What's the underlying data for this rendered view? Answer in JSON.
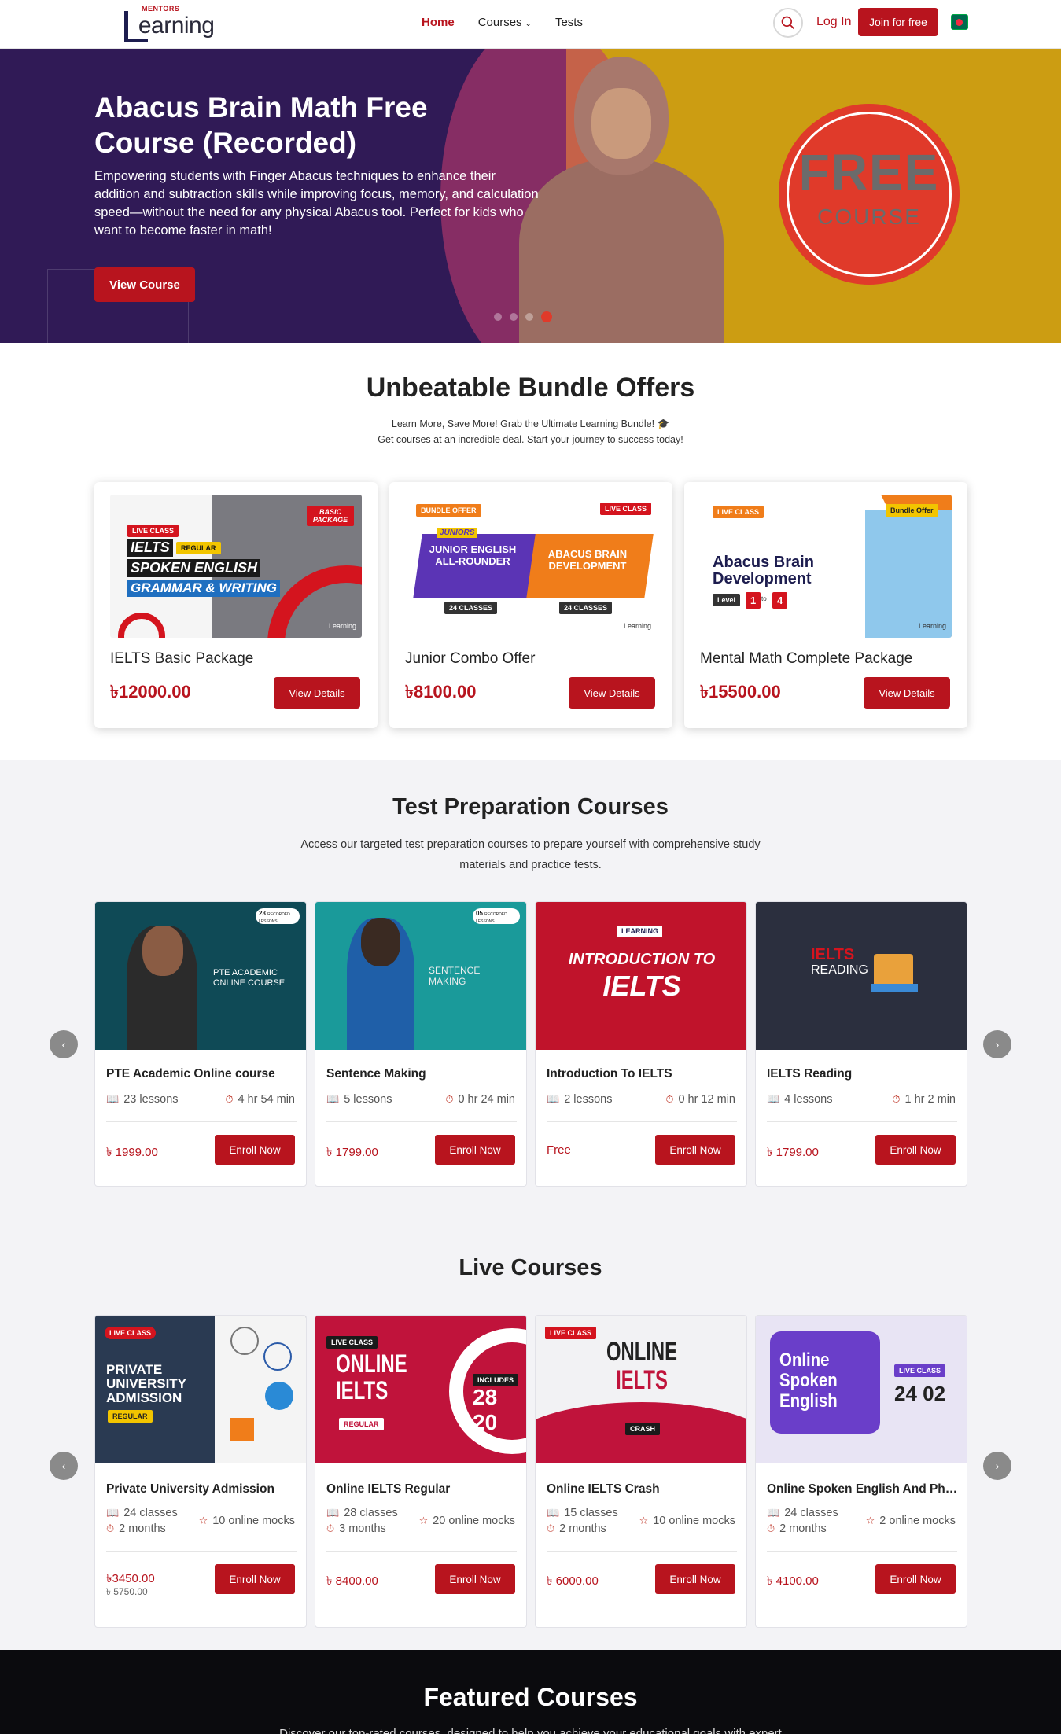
{
  "header": {
    "logo_top": "MENTORS",
    "logo_word": "earning",
    "nav": [
      {
        "label": "Home"
      },
      {
        "label": "Courses"
      },
      {
        "label": "Tests"
      }
    ],
    "login_label": "Log In",
    "join_label": "Join for free",
    "colors": {
      "brand": "#b8141e"
    }
  },
  "hero": {
    "title": "Abacus Brain Math Free Course (Recorded)",
    "description": "Empowering students with Finger Abacus techniques to enhance their addition and subtraction skills while improving focus, memory, and calculation speed—without the need for any physical Abacus tool. Perfect for kids who want to become faster in math!",
    "cta_label": "View Course",
    "badge_line1": "FREE",
    "badge_line2": "COURSE"
  },
  "bundle": {
    "title": "Unbeatable Bundle Offers",
    "subtitle_line1": "Learn More, Save More! Grab the Ultimate Learning Bundle! 🎓",
    "subtitle_line2": "Get courses at an incredible deal. Start your journey to success today!",
    "cards": [
      {
        "name": "IELTS Basic Package",
        "price": "৳12000.00",
        "button": "View Details",
        "art": {
          "tag1": "LIVE CLASS",
          "tag2": "BASIC PACKAGE",
          "line1": "IELTS",
          "line1b": "REGULAR",
          "line2": "SPOKEN ENGLISH",
          "line3": "GRAMMAR & WRITING",
          "brand": "Learning"
        }
      },
      {
        "name": "Junior Combo Offer",
        "price": "৳8100.00",
        "button": "View Details",
        "art": {
          "tag1": "BUNDLE OFFER",
          "tag2": "LIVE CLASS",
          "left_head": "JUNIORS",
          "left": "JUNIOR ENGLISH ALL-ROUNDER",
          "left_sub": "24 CLASSES",
          "right": "ABACUS BRAIN DEVELOPMENT",
          "right_sub": "24 CLASSES",
          "brand": "Learning"
        }
      },
      {
        "name": "Mental Math Complete Package",
        "price": "৳15500.00",
        "button": "View Details",
        "art": {
          "tag1": "LIVE CLASS",
          "tag2": "Bundle Offer",
          "line1": "Abacus Brain",
          "line2": "Development",
          "level": "Level",
          "lv_from": "1",
          "lv_to": "to",
          "lv_end": "4",
          "brand": "Learning"
        }
      }
    ]
  },
  "test_prep": {
    "title": "Test Preparation Courses",
    "subtitle_line1": "Access our targeted test preparation courses to prepare yourself with comprehensive study",
    "subtitle_line2": "materials and practice tests.",
    "courses": [
      {
        "title": "PTE Academic Online course",
        "lessons": "23 lessons",
        "duration": "4 hr 54 min",
        "price": "৳ 1999.00",
        "button": "Enroll Now",
        "art": {
          "line1": "PTE ACADEMIC",
          "line2": "ONLINE COURSE",
          "badge": "23",
          "badge_sub": "RECORDED LESSONS"
        }
      },
      {
        "title": "Sentence Making",
        "lessons": "5 lessons",
        "duration": "0 hr 24 min",
        "price": "৳ 1799.00",
        "button": "Enroll Now",
        "art": {
          "line1": "SENTENCE",
          "line2": "MAKING",
          "badge": "05",
          "badge_sub": "RECORDED LESSONS"
        }
      },
      {
        "title": "Introduction To IELTS",
        "lessons": "2 lessons",
        "duration": "0 hr 12 min",
        "price": "Free",
        "button": "Enroll Now",
        "art": {
          "line1": "INTRODUCTION TO",
          "line2": "IELTS",
          "brand": "LEARNING"
        }
      },
      {
        "title": "IELTS Reading",
        "lessons": "4 lessons",
        "duration": "1 hr 2 min",
        "price": "৳ 1799.00",
        "button": "Enroll Now",
        "art": {
          "line1": "IELTS",
          "line2": "READING"
        }
      }
    ]
  },
  "live_courses": {
    "title": "Live Courses",
    "courses": [
      {
        "title": "Private University Admission",
        "classes": "24 classes",
        "months": "2 months",
        "mocks": "10 online mocks",
        "price": "৳3450.00",
        "old_price": "৳ 5750.00",
        "button": "Enroll Now",
        "art": {
          "tag": "LIVE CLASS",
          "line1": "PRIVATE",
          "line2": "UNIVERSITY",
          "line3": "ADMISSION",
          "sub": "REGULAR"
        }
      },
      {
        "title": "Online IELTS Regular",
        "classes": "28 classes",
        "months": "3 months",
        "mocks": "20 online mocks",
        "price": "৳ 8400.00",
        "old_price": "",
        "button": "Enroll Now",
        "art": {
          "tag": "LIVE CLASS",
          "line1": "ONLINE",
          "line2": "IELTS",
          "sub": "REGULAR",
          "inc": "INCLUDES",
          "n1": "28",
          "n2": "20"
        }
      },
      {
        "title": "Online IELTS Crash",
        "classes": "15 classes",
        "months": "2 months",
        "mocks": "10 online mocks",
        "price": "৳ 6000.00",
        "old_price": "",
        "button": "Enroll Now",
        "art": {
          "tag": "LIVE CLASS",
          "line1": "ONLINE",
          "line2": "IELTS",
          "sub": "CRASH"
        }
      },
      {
        "title": "Online Spoken English And Phonetics",
        "classes": "24 classes",
        "months": "2 months",
        "mocks": "2 online mocks",
        "price": "৳ 4100.00",
        "old_price": "",
        "button": "Enroll Now",
        "art": {
          "tag": "LIVE CLASS",
          "line1": "Online",
          "line2": "Spoken",
          "line3": "English",
          "n1": "24",
          "n2": "02"
        }
      }
    ]
  },
  "featured": {
    "title": "Featured Courses",
    "subtitle": "Discover our top-rated courses, designed to help you achieve your educational goals with expert"
  }
}
